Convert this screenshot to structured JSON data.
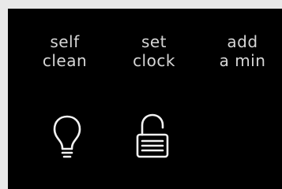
{
  "controls": [
    {
      "line1": "self",
      "line2": "clean",
      "icon": "lightbulb-icon"
    },
    {
      "line1": "set",
      "line2": "clock",
      "icon": "lock-open-icon"
    },
    {
      "line1": "add",
      "line2": "a min",
      "icon": ""
    }
  ],
  "colors": {
    "frame": "#e9e9e9",
    "panel": "#000000",
    "text": "#d6d6d6",
    "icon_stroke": "#f2f2f2"
  }
}
